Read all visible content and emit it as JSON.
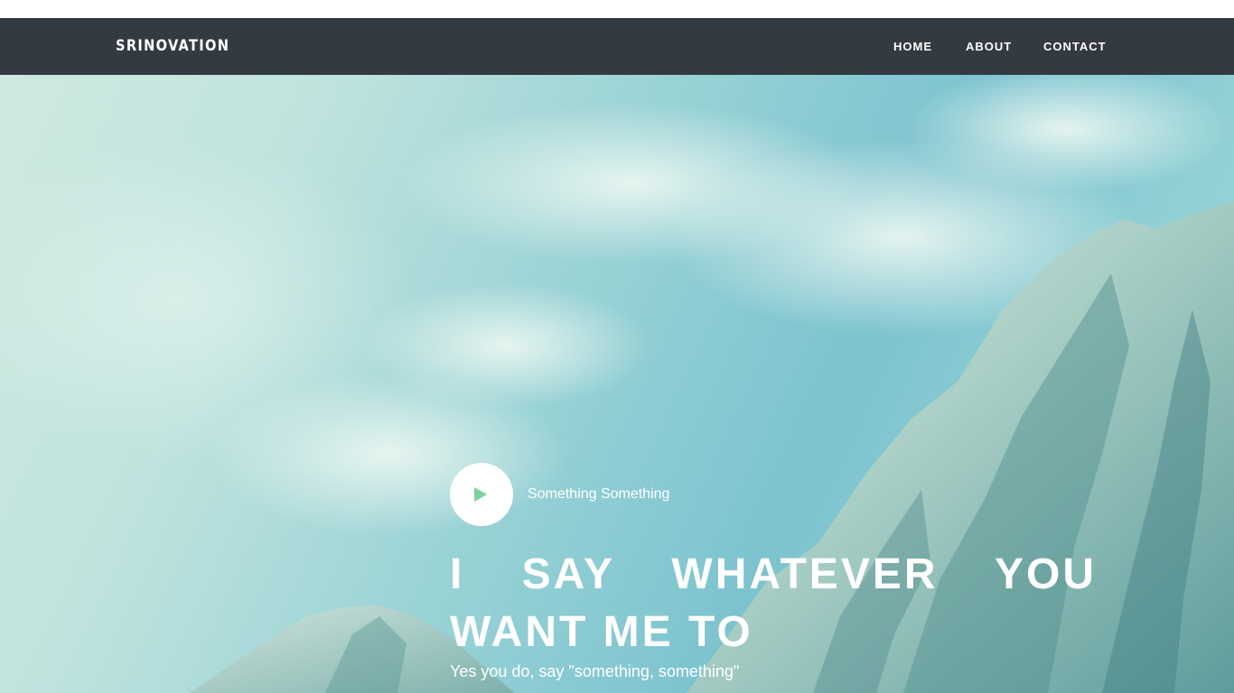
{
  "brand": "SRINOVATION",
  "nav": {
    "home": "HOME",
    "about": "ABOUT",
    "contact": "CONTACT"
  },
  "hero": {
    "play_label": "Something Something",
    "headline": "I SAY WHATEVER YOU WANT ME TO",
    "subline": "Yes you do, say \"something, something\""
  },
  "icons": {
    "play": "play-icon"
  },
  "colors": {
    "navbar": "#343a42",
    "play_accent": "#7bd29a",
    "text": "#ffffff"
  }
}
